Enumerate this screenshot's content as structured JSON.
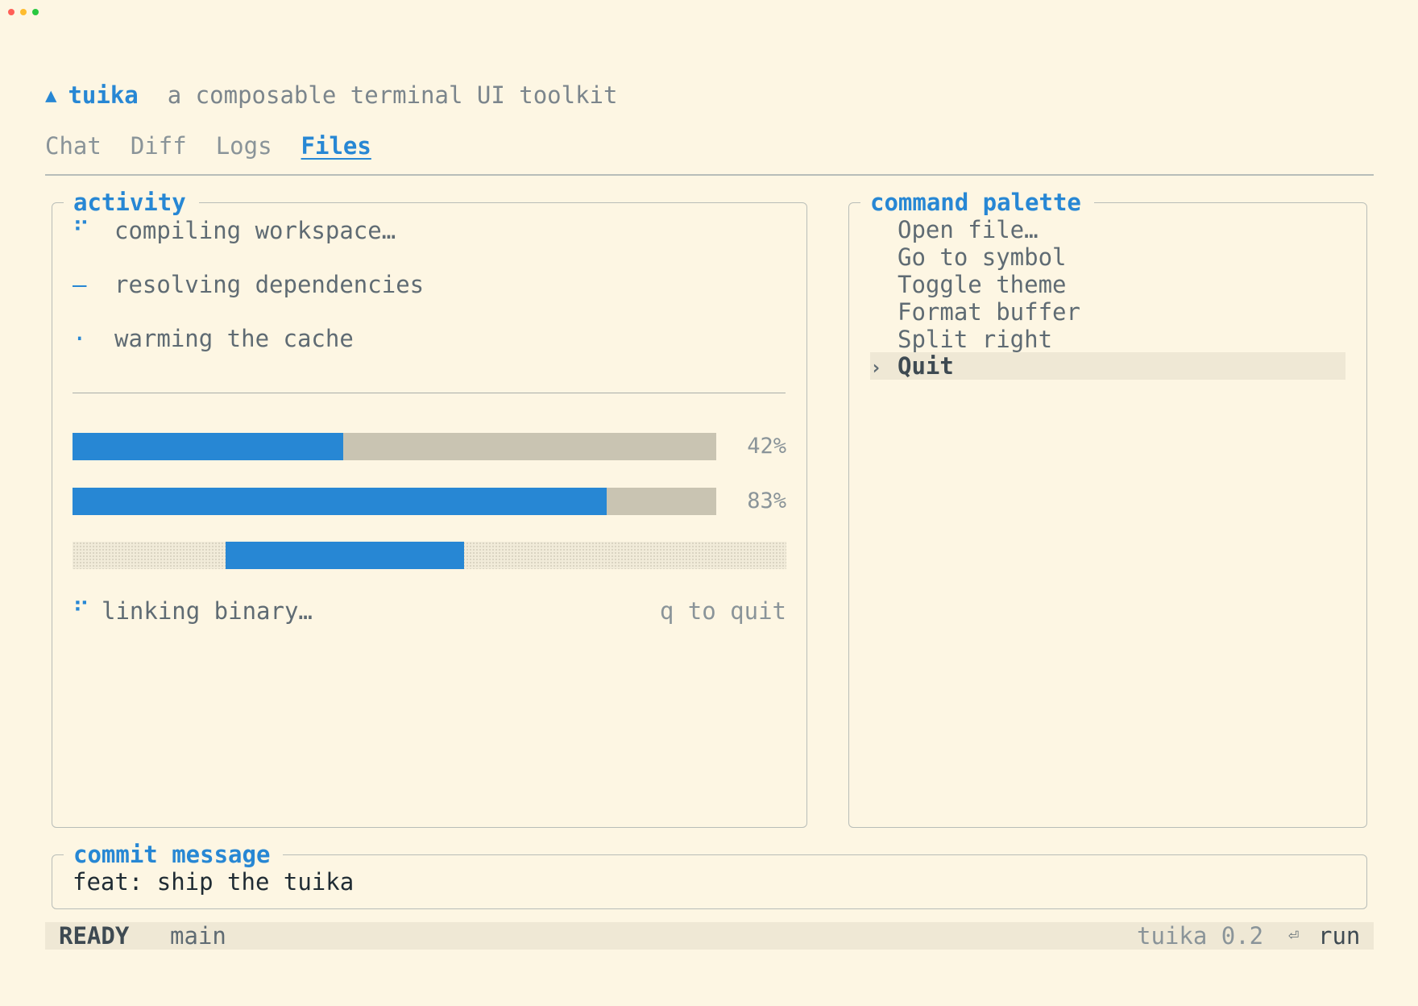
{
  "window": {
    "controls": [
      {
        "name": "close",
        "color": "#ff5f57"
      },
      {
        "name": "minimize",
        "color": "#febc2e"
      },
      {
        "name": "zoom",
        "color": "#28c840"
      }
    ]
  },
  "header": {
    "logo_glyph": "▲",
    "app_name": "tuika",
    "tagline": "a composable terminal UI toolkit"
  },
  "tabs": [
    {
      "label": "Chat",
      "active": false
    },
    {
      "label": "Diff",
      "active": false
    },
    {
      "label": "Logs",
      "active": false
    },
    {
      "label": "Files",
      "active": true
    }
  ],
  "activity": {
    "title": "activity",
    "tasks": [
      {
        "spinner": "⠋",
        "label": "compiling workspace…"
      },
      {
        "spinner": "–",
        "label": "resolving dependencies"
      },
      {
        "spinner": "·",
        "label": "warming the cache"
      }
    ],
    "progress": [
      {
        "value": 42,
        "label": "42%"
      },
      {
        "value": 83,
        "label": "83%"
      }
    ],
    "indeterminate": {
      "start": 0.215,
      "end": 0.548
    },
    "status": {
      "spinner": "⠋",
      "label": "linking binary…",
      "hint": "q to quit"
    }
  },
  "palette": {
    "title": "command palette",
    "items": [
      {
        "label": "Open file…",
        "selected": false
      },
      {
        "label": "Go to symbol",
        "selected": false
      },
      {
        "label": "Toggle theme",
        "selected": false
      },
      {
        "label": "Format buffer",
        "selected": false
      },
      {
        "label": "Split right",
        "selected": false
      },
      {
        "label": "Quit",
        "selected": true
      }
    ],
    "selection_glyph": "›"
  },
  "commit": {
    "title": "commit message",
    "value": "feat: ship the tuika"
  },
  "statusbar": {
    "mode": "READY",
    "branch": "main",
    "version": "tuika 0.2",
    "run_glyph": "⏎",
    "run_label": "run"
  },
  "colors": {
    "background": "#fdf6e3",
    "accent": "#2787d4",
    "track": "#c9c4b2",
    "selection": "#efe8d5"
  }
}
